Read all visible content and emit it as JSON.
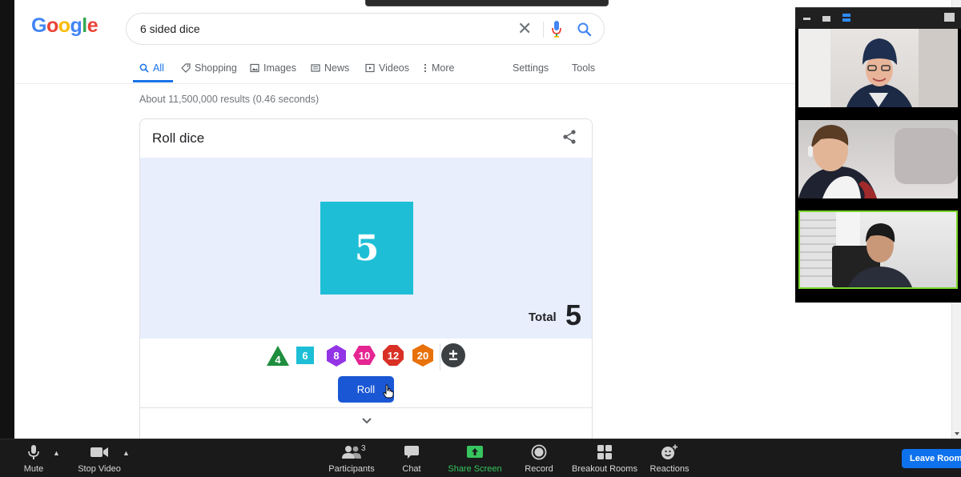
{
  "search": {
    "query": "6 sided dice",
    "clear_glyph": "✕"
  },
  "logo": {
    "letters": [
      "G",
      "o",
      "o",
      "g",
      "l",
      "e"
    ],
    "colors": [
      "#4285f4",
      "#ea4335",
      "#fbbc05",
      "#4285f4",
      "#34a853",
      "#ea4335"
    ]
  },
  "tabs": [
    {
      "label": "All",
      "icon": "search-icon",
      "active": true
    },
    {
      "label": "Shopping",
      "icon": "tag-icon"
    },
    {
      "label": "Images",
      "icon": "image-icon"
    },
    {
      "label": "News",
      "icon": "newspaper-icon"
    },
    {
      "label": "Videos",
      "icon": "play-icon"
    },
    {
      "label": "More",
      "icon": "more-vert-icon"
    }
  ],
  "tools": {
    "settings": "Settings",
    "tools": "Tools"
  },
  "results_count": "About 11,500,000 results (0.46 seconds)",
  "dice_card": {
    "title": "Roll dice",
    "die_value": "5",
    "die_color": "#1ebfd6",
    "total_label": "Total",
    "total_value": "5",
    "dice_types": [
      {
        "label": "4",
        "color": "#1e8e3e",
        "shape": "triangle"
      },
      {
        "label": "6",
        "color": "#1ebfd6",
        "shape": "square"
      },
      {
        "label": "8",
        "color": "#9334e6",
        "shape": "hexagon"
      },
      {
        "label": "10",
        "color": "#e52592",
        "shape": "hexagon-wide"
      },
      {
        "label": "12",
        "color": "#d93025",
        "shape": "octagon"
      },
      {
        "label": "20",
        "color": "#e8710a",
        "shape": "hexagon"
      },
      {
        "label": "±",
        "color": "#3c4043",
        "shape": "circle"
      }
    ],
    "roll_label": "Roll"
  },
  "video_panel": {
    "participants": [
      "participant-1",
      "participant-2",
      "participant-3"
    ]
  },
  "zoom_bar": {
    "mute": "Mute",
    "stop_video": "Stop Video",
    "participants": "Participants",
    "participants_count": "3",
    "chat": "Chat",
    "share_screen": "Share Screen",
    "record": "Record",
    "breakout_rooms": "Breakout Rooms",
    "reactions": "Reactions",
    "leave": "Leave Room",
    "accent_green": "#36c55e",
    "accent_blue": "#0e72ed"
  }
}
